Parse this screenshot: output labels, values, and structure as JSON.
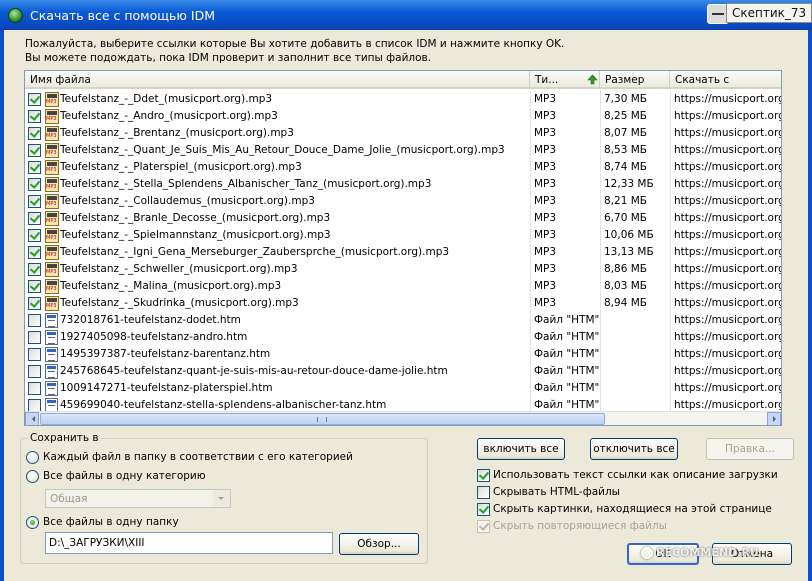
{
  "window": {
    "title": "Скачать все с помощью IDM",
    "user_badge": "Скептик_73"
  },
  "intro": {
    "line1": "Пожалуйста, выберите ссылки которые Вы хотите добавить в список IDM и нажмите кнопку OK.",
    "line2": "Вы можете подождать, пока IDM проверит и заполнит все типы файлов."
  },
  "table": {
    "columns": {
      "name": "Имя файла",
      "type": "Ти...",
      "size": "Размер",
      "url": "Скачать с"
    },
    "rows": [
      {
        "checked": true,
        "icon": "mp3-file-icon",
        "name": "Teufelstanz_-_Ddet_(musicport.org).mp3",
        "type": "MP3",
        "size": "7,30  МБ",
        "url": "https://musicport.org"
      },
      {
        "checked": true,
        "icon": "mp3-file-icon",
        "name": "Teufelstanz_-_Andro_(musicport.org).mp3",
        "type": "MP3",
        "size": "8,25  МБ",
        "url": "https://musicport.org"
      },
      {
        "checked": true,
        "icon": "mp3-file-icon",
        "name": "Teufelstanz_-_Brentanz_(musicport.org).mp3",
        "type": "MP3",
        "size": "8,07  МБ",
        "url": "https://musicport.org"
      },
      {
        "checked": true,
        "icon": "mp3-file-icon",
        "name": "Teufelstanz_-_Quant_Je_Suis_Mis_Au_Retour_Douce_Dame_Jolie_(musicport.org).mp3",
        "type": "MP3",
        "size": "8,53  МБ",
        "url": "https://musicport.org"
      },
      {
        "checked": true,
        "icon": "mp3-file-icon",
        "name": "Teufelstanz_-_Platerspiel_(musicport.org).mp3",
        "type": "MP3",
        "size": "8,74  МБ",
        "url": "https://musicport.org"
      },
      {
        "checked": true,
        "icon": "mp3-file-icon",
        "name": "Teufelstanz_-_Stella_Splendens_Albanischer_Tanz_(musicport.org).mp3",
        "type": "MP3",
        "size": "12,33  МБ",
        "url": "https://musicport.org"
      },
      {
        "checked": true,
        "icon": "mp3-file-icon",
        "name": "Teufelstanz_-_Collaudemus_(musicport.org).mp3",
        "type": "MP3",
        "size": "8,21  МБ",
        "url": "https://musicport.org"
      },
      {
        "checked": true,
        "icon": "mp3-file-icon",
        "name": "Teufelstanz_-_Branle_Decosse_(musicport.org).mp3",
        "type": "MP3",
        "size": "6,70  МБ",
        "url": "https://musicport.org"
      },
      {
        "checked": true,
        "icon": "mp3-file-icon",
        "name": "Teufelstanz_-_Spielmannstanz_(musicport.org).mp3",
        "type": "MP3",
        "size": "10,06  МБ",
        "url": "https://musicport.org"
      },
      {
        "checked": true,
        "icon": "mp3-file-icon",
        "name": "Teufelstanz_-_Igni_Gena_Merseburger_Zaubersprche_(musicport.org).mp3",
        "type": "MP3",
        "size": "13,13  МБ",
        "url": "https://musicport.org"
      },
      {
        "checked": true,
        "icon": "mp3-file-icon",
        "name": "Teufelstanz_-_Schweller_(musicport.org).mp3",
        "type": "MP3",
        "size": "8,86  МБ",
        "url": "https://musicport.org"
      },
      {
        "checked": true,
        "icon": "mp3-file-icon",
        "name": "Teufelstanz_-_Malina_(musicport.org).mp3",
        "type": "MP3",
        "size": "8,03  МБ",
        "url": "https://musicport.org"
      },
      {
        "checked": true,
        "icon": "mp3-file-icon",
        "name": "Teufelstanz_-_Skudrinka_(musicport.org).mp3",
        "type": "MP3",
        "size": "8,94  МБ",
        "url": "https://musicport.org"
      },
      {
        "checked": false,
        "icon": "htm-file-icon",
        "name": "732018761-teufelstanz-dodet.htm",
        "type": "Файл \"HTM\"",
        "size": "",
        "url": "https://musicport.org"
      },
      {
        "checked": false,
        "icon": "htm-file-icon",
        "name": "1927405098-teufelstanz-andro.htm",
        "type": "Файл \"HTM\"",
        "size": "",
        "url": "https://musicport.org"
      },
      {
        "checked": false,
        "icon": "htm-file-icon",
        "name": "1495397387-teufelstanz-barentanz.htm",
        "type": "Файл \"HTM\"",
        "size": "",
        "url": "https://musicport.org"
      },
      {
        "checked": false,
        "icon": "htm-file-icon",
        "name": "245768645-teufelstanz-quant-je-suis-mis-au-retour-douce-dame-jolie.htm",
        "type": "Файл \"HTM\"",
        "size": "",
        "url": "https://musicport.org"
      },
      {
        "checked": false,
        "icon": "htm-file-icon",
        "name": "1009147271-teufelstanz-platerspiel.htm",
        "type": "Файл \"HTM\"",
        "size": "",
        "url": "https://musicport.org"
      },
      {
        "checked": false,
        "icon": "htm-file-icon",
        "name": "459699040-teufelstanz-stella-splendens-albanischer-tanz.htm",
        "type": "Файл \"HTM\"",
        "size": "",
        "url": "https://musicport.org"
      }
    ]
  },
  "save": {
    "group_label": "Сохранить в",
    "option_by_category": "Каждый файл в папку в соответствии с его категорией",
    "option_one_category": "Все файлы в одну категорию",
    "category_value": "Общая",
    "option_one_folder": "Все файлы в одну папку",
    "selected_option": "one_folder",
    "folder_path": "D:\\_ЗАГРУЗКИ\\XIII",
    "browse_label": "Обзор..."
  },
  "buttons": {
    "select_all": "включить все",
    "deselect_all": "отключить все",
    "edit": "Правка...",
    "ok": "OK",
    "cancel": "Отмена"
  },
  "options": [
    {
      "label": "Использовать текст ссылки как описание загрузки",
      "checked": true,
      "enabled": true
    },
    {
      "label": "Скрывать HTML-файлы",
      "checked": false,
      "enabled": true
    },
    {
      "label": "Скрыть картинки, находящиеся на этой странице",
      "checked": true,
      "enabled": true
    },
    {
      "label": "Скрыть повторяющиеся файлы",
      "checked": true,
      "enabled": false
    }
  ],
  "watermark": "RECOMMEND.RU"
}
